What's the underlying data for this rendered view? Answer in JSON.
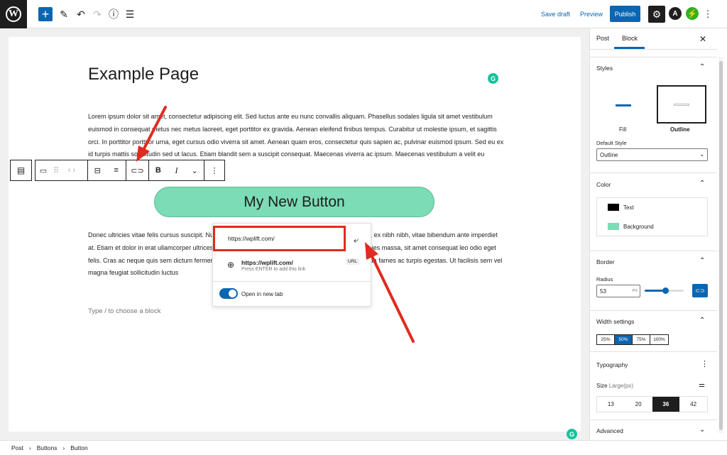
{
  "topbar": {
    "add_icon": "+",
    "edit_icon": "pencil-icon",
    "undo_icon": "undo-icon",
    "redo_icon": "redo-icon",
    "info_icon": "info-icon",
    "list_view_icon": "list-view-icon",
    "save_draft": "Save draft",
    "preview": "Preview",
    "publish": "Publish",
    "settings_icon": "gear-icon",
    "astra_label": "A",
    "jetpack_label": "⚡"
  },
  "editor": {
    "title": "Example Page",
    "grammarly_label": "G",
    "paragraph1": "Lorem ipsum dolor sit amet, consectetur adipiscing elit. Sed luctus ante eu nunc convallis aliquam. Phasellus sodales ligula sit amet vestibulum euismod in consequat metus nec metus laoreet, eget porttitor ex gravida. Aenean eleifend finibus tempus. Curabitur ut molestie ipsum, et sagittis orci. In porttitor porttitor urna, eget cursus odio viverra sit amet. Aenean quam eros, consectetur quis sapien ac, pulvinar euismod ipsum. Sed eu ex id turpis mattis sollicitudin sed ut lacus. Etiam blandit sem a suscipit consequat. Maecenas viverra ac ipsum. Maecenas vestibulum a velit eu mattis.",
    "button_text": "My New Button",
    "paragraph2": "Donec ultricies vitae felis cursus suscipit. Nulla facilisi. Quisque pretium, sapien vel pulvinar aliquam, ex nibh nibh, vitae bibendum ante imperdiet at. Etiam et dolor in erat ullamcorper ultrices. Vestibulum nec malesuada ligula. Donec ut quam ultricies massa, sit amet consequat leo odio eget felis. Cras ac neque quis sem dictum fermentum. Nulla morbi tristique senectus et netus et malesuada fames ac turpis egestas. Ut facilisis sem vel magna feugiat sollicitudin luctus",
    "placeholder": "Type / to choose a block"
  },
  "link_popover": {
    "url_value": "https://wplift.com/",
    "suggestion_title": "https://wplift.com/",
    "suggestion_hint": "Press ENTER to add this link",
    "suggestion_badge": "URL",
    "open_new_tab": "Open in new tab"
  },
  "sidebar": {
    "tabs": [
      "Post",
      "Block"
    ],
    "styles": {
      "title": "Styles",
      "fill_label": "Fill",
      "outline_label": "Outline",
      "default_style_label": "Default Style",
      "default_style_value": "Outline"
    },
    "color": {
      "title": "Color",
      "text_label": "Text",
      "text_color": "#000000",
      "background_label": "Background",
      "background_color": "#7bdcb5"
    },
    "border": {
      "title": "Border",
      "radius_label": "Radius",
      "radius_value": "53",
      "radius_unit": "PX"
    },
    "width": {
      "title": "Width settings",
      "options": [
        "25%",
        "50%",
        "75%",
        "100%"
      ],
      "selected": "50%"
    },
    "typography": {
      "title": "Typography",
      "size_label": "Size",
      "size_hint": "Large(px)",
      "sizes": [
        "13",
        "20",
        "36",
        "42"
      ],
      "selected": "36"
    },
    "advanced": {
      "title": "Advanced"
    }
  },
  "breadcrumbs": [
    "Post",
    "Buttons",
    "Button"
  ],
  "colors": {
    "accent": "#0a66b2",
    "annotation_red": "#e02b20",
    "button_bg": "#7bdcb5"
  }
}
